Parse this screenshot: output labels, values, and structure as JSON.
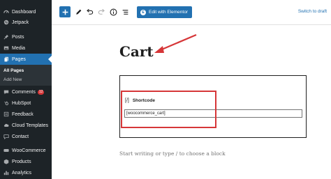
{
  "sidebar": {
    "items": [
      {
        "label": "Dashboard",
        "icon": "dashboard-icon"
      },
      {
        "label": "Jetpack",
        "icon": "jetpack-icon"
      },
      {
        "label": "Posts",
        "icon": "pin-icon"
      },
      {
        "label": "Media",
        "icon": "media-icon"
      },
      {
        "label": "Pages",
        "icon": "pages-icon"
      },
      {
        "label": "Comments",
        "icon": "comments-icon",
        "badge": "12"
      },
      {
        "label": "HubSpot",
        "icon": "hubspot-icon"
      },
      {
        "label": "Feedback",
        "icon": "feedback-icon"
      },
      {
        "label": "Cloud Templates",
        "icon": "cloud-icon"
      },
      {
        "label": "Contact",
        "icon": "contact-icon"
      },
      {
        "label": "WooCommerce",
        "icon": "woocommerce-icon"
      },
      {
        "label": "Products",
        "icon": "products-icon"
      },
      {
        "label": "Analytics",
        "icon": "analytics-icon"
      }
    ],
    "submenu": [
      {
        "label": "All Pages"
      },
      {
        "label": "Add New"
      }
    ]
  },
  "toolbar": {
    "elementor_label": "Edit with Elementor",
    "switch_draft_label": "Switch to draft"
  },
  "editor": {
    "title": "Cart",
    "block_label": "Shortcode",
    "block_icon_glyph": "[/]",
    "shortcode_value": "[woocommerce_cart]",
    "placeholder": "Start writing or type / to choose a block"
  },
  "colors": {
    "sidebar_bg": "#1d2327",
    "accent": "#2271b1",
    "highlight": "#d63638"
  }
}
